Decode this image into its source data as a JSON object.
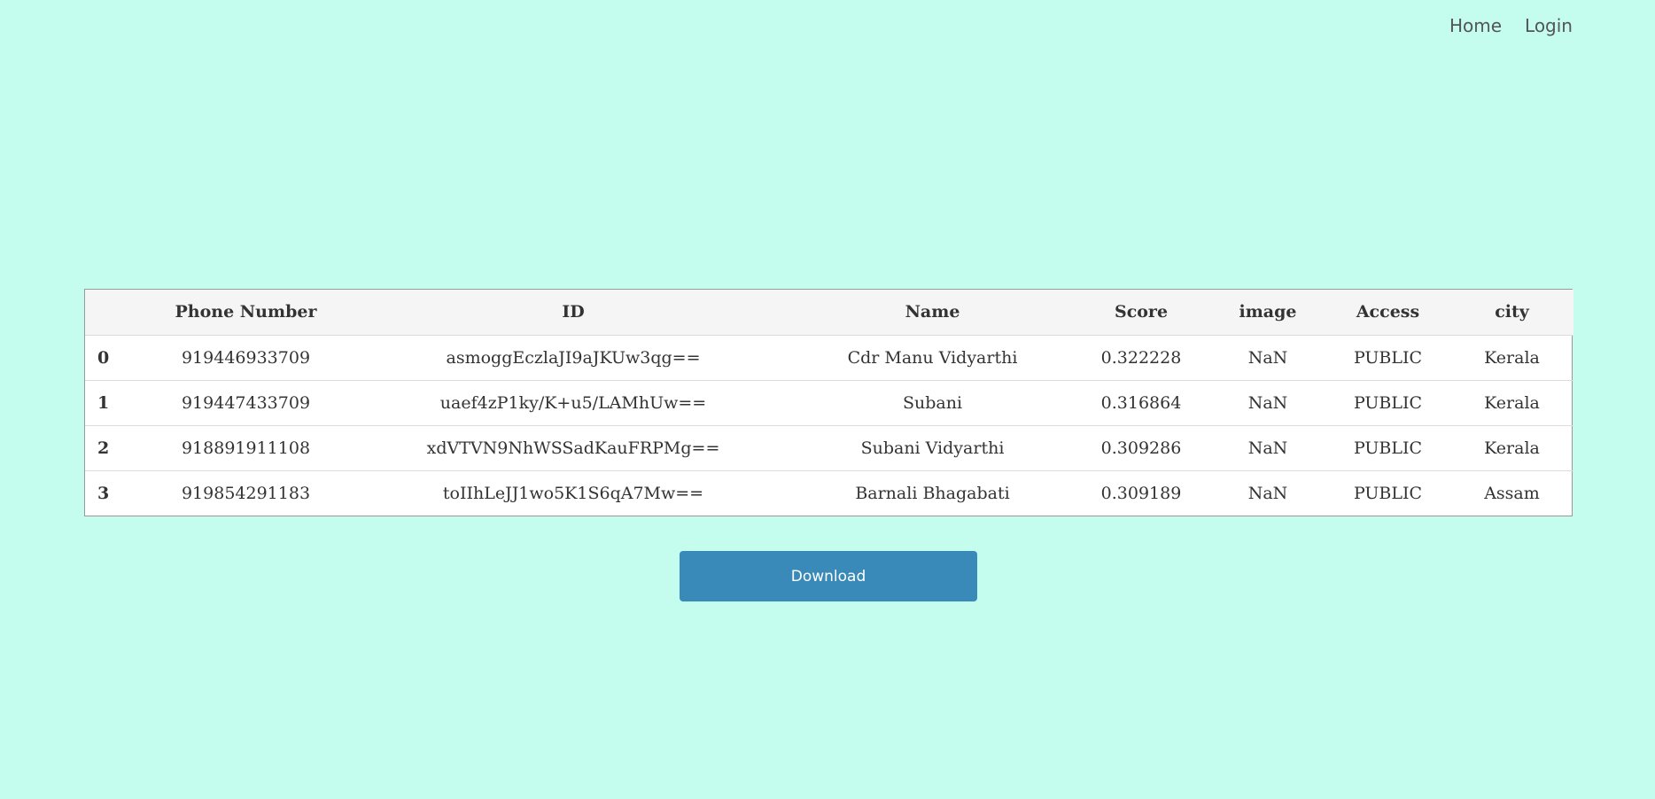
{
  "nav": {
    "home_label": "Home",
    "login_label": "Login"
  },
  "table": {
    "headers": [
      "",
      "Phone Number",
      "ID",
      "Name",
      "Score",
      "image",
      "Access",
      "city"
    ],
    "rows": [
      [
        "0",
        "919446933709",
        "asmoggEczlaJI9aJKUw3qg==",
        "Cdr Manu Vidyarthi",
        "0.322228",
        "NaN",
        "PUBLIC",
        "Kerala"
      ],
      [
        "1",
        "919447433709",
        "uaef4zP1ky/K+u5/LAMhUw==",
        "Subani",
        "0.316864",
        "NaN",
        "PUBLIC",
        "Kerala"
      ],
      [
        "2",
        "918891911108",
        "xdVTVN9NhWSSadKauFRPMg==",
        "Subani Vidyarthi",
        "0.309286",
        "NaN",
        "PUBLIC",
        "Kerala"
      ],
      [
        "3",
        "919854291183",
        "toIIhLeJJ1wo5K1S6qA7Mw==",
        "Barnali Bhagabati",
        "0.309189",
        "NaN",
        "PUBLIC",
        "Assam"
      ]
    ]
  },
  "download": {
    "label": "Download"
  },
  "colors": {
    "background": "#c4fcee",
    "button": "#3989b9",
    "header_row": "#f5f5f5"
  }
}
